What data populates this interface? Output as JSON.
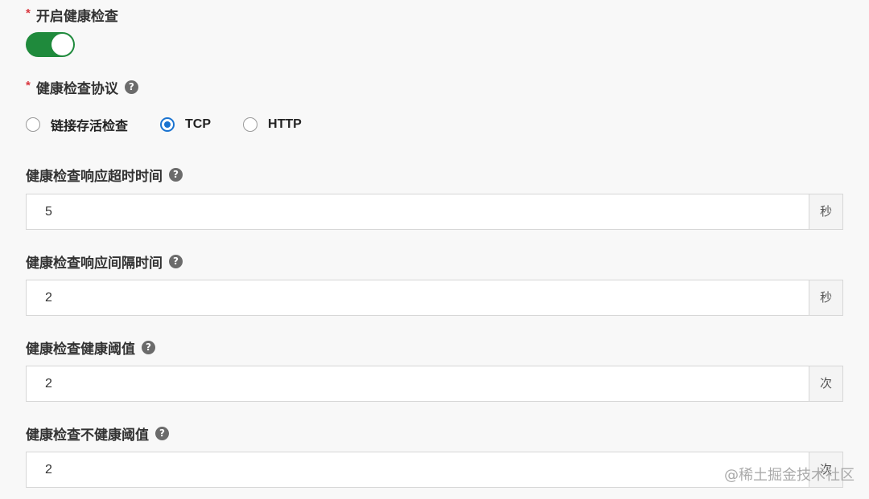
{
  "enable_health_check": {
    "required_mark": "*",
    "label": "开启健康检查",
    "enabled": true
  },
  "protocol": {
    "required_mark": "*",
    "label": "健康检查协议",
    "help_icon": "question-circle-icon",
    "help_glyph": "?",
    "options": [
      {
        "label": "链接存活检查",
        "checked": false
      },
      {
        "label": "TCP",
        "checked": true
      },
      {
        "label": "HTTP",
        "checked": false
      }
    ]
  },
  "fields": [
    {
      "label": "健康检查响应超时时间",
      "help_glyph": "?",
      "value": "5",
      "unit": "秒"
    },
    {
      "label": "健康检查响应间隔时间",
      "help_glyph": "?",
      "value": "2",
      "unit": "秒"
    },
    {
      "label": "健康检查健康阈值",
      "help_glyph": "?",
      "value": "2",
      "unit": "次"
    },
    {
      "label": "健康检查不健康阈值",
      "help_glyph": "?",
      "value": "2",
      "unit": "次"
    }
  ],
  "colors": {
    "toggle_on": "#1f8a3c",
    "radio_checked": "#1a73d0",
    "required": "#d9363e"
  },
  "watermark": "@稀土掘金技术社区"
}
